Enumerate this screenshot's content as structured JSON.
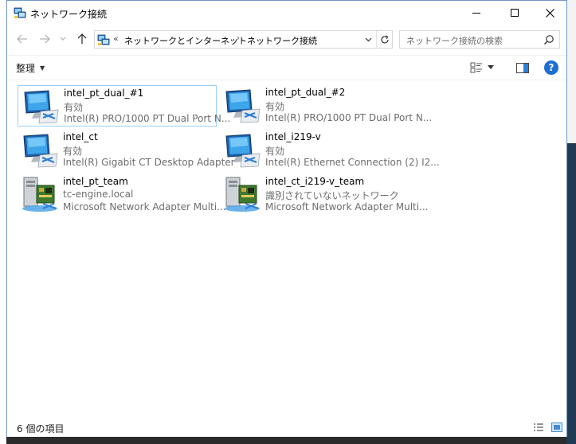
{
  "window": {
    "title": "ネットワーク接続",
    "minimize_label": "",
    "close_glyph": "✕"
  },
  "nav": {
    "back_glyph": "←",
    "forward_glyph": "→",
    "recent_glyph": "⌄",
    "up_glyph": "↑"
  },
  "address": {
    "overflow": "«",
    "crumbs": [
      "ネットワークとインターネット",
      "ネットワーク接続"
    ],
    "arrow": "›"
  },
  "search": {
    "placeholder": "ネットワーク接続の検索"
  },
  "toolbar": {
    "organize_label": "整理",
    "caret": "▼",
    "help_label": "?"
  },
  "items": [
    {
      "name": "intel_pt_dual_#1",
      "status": "有効",
      "device": "Intel(R) PRO/1000 PT Dual Port N...",
      "icon": "network-adapter-icon"
    },
    {
      "name": "intel_pt_dual_#2",
      "status": "有効",
      "device": "Intel(R) PRO/1000 PT Dual Port N...",
      "icon": "network-adapter-icon"
    },
    {
      "name": "intel_ct",
      "status": "有効",
      "device": "Intel(R) Gigabit CT Desktop Adapter",
      "icon": "network-adapter-icon"
    },
    {
      "name": "intel_i219-v",
      "status": "有効",
      "device": "Intel(R) Ethernet Connection (2) I2...",
      "icon": "network-adapter-icon"
    },
    {
      "name": "intel_pt_team",
      "status": "tc-engine.local",
      "device": "Microsoft Network Adapter Multi...",
      "icon": "network-team-icon"
    },
    {
      "name": "intel_ct_i219-v_team",
      "status": "識別されていないネットワーク",
      "device": "Microsoft Network Adapter Multi...",
      "icon": "network-team-icon"
    }
  ],
  "statusbar": {
    "item_count": "6 個の項目"
  },
  "colors": {
    "selection_border": "#99d1ff",
    "help_blue": "#1e6fd1",
    "window_border": "#6f96c6"
  }
}
